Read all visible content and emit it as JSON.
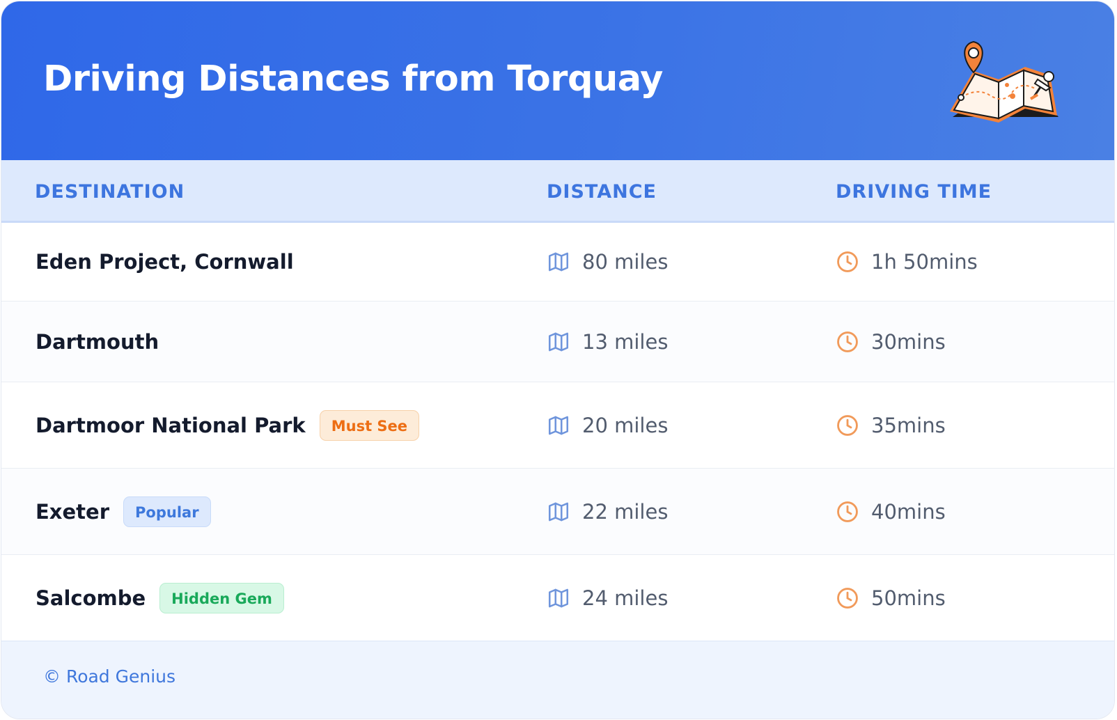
{
  "header": {
    "title": "Driving Distances from Torquay",
    "illustration_icon": "map-pin-illustration"
  },
  "table": {
    "columns": [
      "DESTINATION",
      "DISTANCE",
      "DRIVING TIME"
    ],
    "distance_icon": "map-icon",
    "time_icon": "clock-icon",
    "rows": [
      {
        "destination": "Eden Project, Cornwall",
        "badge": "",
        "distance": "80 miles",
        "time": "1h 50mins"
      },
      {
        "destination": "Dartmouth",
        "badge": "",
        "distance": "13 miles",
        "time": "30mins"
      },
      {
        "destination": "Dartmoor National Park",
        "badge": "Must See",
        "badge_color": "#ed6e14",
        "distance": "20 miles",
        "time": "35mins"
      },
      {
        "destination": "Exeter",
        "badge": "Popular",
        "badge_color": "#3d78dc",
        "distance": "22 miles",
        "time": "40mins"
      },
      {
        "destination": "Salcombe",
        "badge": "Hidden Gem",
        "badge_color": "#19a95a",
        "distance": "24 miles",
        "time": "50mins"
      }
    ]
  },
  "footer": {
    "text": "© Road Genius"
  },
  "colors": {
    "header_start": "#2f68e8",
    "header_end": "#4a80e4",
    "column_header_bg": "#dde9fd",
    "column_header_text": "#3d75df",
    "map_icon": "#6f95dc",
    "clock_icon": "#f19a5a",
    "footer_bg": "#eef4fe",
    "footer_text": "#3f77dc"
  }
}
